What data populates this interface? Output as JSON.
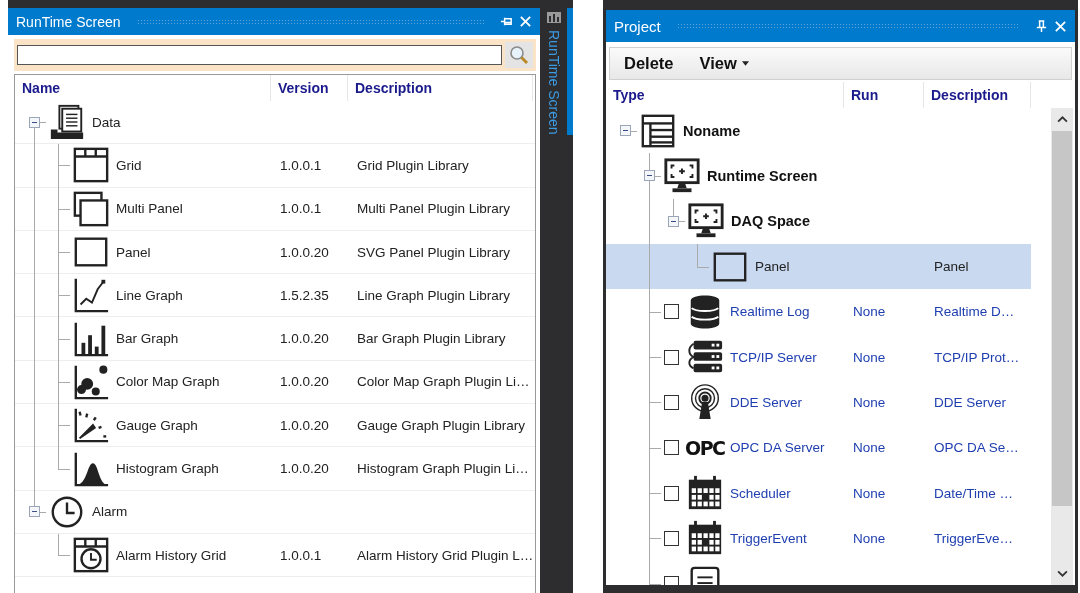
{
  "runtime_panel": {
    "title": "RunTime Screen",
    "columns": [
      "Name",
      "Version",
      "Description"
    ],
    "tree": [
      {
        "name": "Data",
        "kind": "data",
        "expanded": true,
        "children": [
          {
            "name": "Grid",
            "kind": "grid",
            "version": "1.0.0.1",
            "description": "Grid Plugin Library"
          },
          {
            "name": "Multi Panel",
            "kind": "multi-panel",
            "version": "1.0.0.1",
            "description": "Multi Panel Plugin Library"
          },
          {
            "name": "Panel",
            "kind": "panel",
            "version": "1.0.0.20",
            "description": "SVG Panel Plugin Library"
          },
          {
            "name": "Line Graph",
            "kind": "line-graph",
            "version": "1.5.2.35",
            "description": "Line Graph Plugin Library"
          },
          {
            "name": "Bar Graph",
            "kind": "bar-graph",
            "version": "1.0.0.20",
            "description": "Bar Graph Plugin Library"
          },
          {
            "name": "Color Map Graph",
            "kind": "color-map",
            "version": "1.0.0.20",
            "description": "Color Map Graph Plugin Li…"
          },
          {
            "name": "Gauge Graph",
            "kind": "gauge",
            "version": "1.0.0.20",
            "description": "Gauge Graph Plugin Library"
          },
          {
            "name": "Histogram Graph",
            "kind": "histogram",
            "version": "1.0.0.20",
            "description": "Histogram Graph Plugin Li…"
          }
        ]
      },
      {
        "name": "Alarm",
        "kind": "alarm",
        "expanded": true,
        "children": [
          {
            "name": "Alarm History Grid",
            "kind": "alarm-grid",
            "version": "1.0.0.1",
            "description": "Alarm History Grid Plugin L…"
          }
        ]
      }
    ]
  },
  "side_tab": {
    "label": "RunTime Screen"
  },
  "project_panel": {
    "title": "Project",
    "toolbar": [
      {
        "label": "Delete",
        "kind": "button"
      },
      {
        "label": "View",
        "kind": "dropdown"
      }
    ],
    "columns": [
      "Type",
      "Run",
      "Description"
    ],
    "tree": [
      {
        "name": "Noname",
        "kind": "project",
        "expanded": true,
        "selected": false,
        "children": [
          {
            "name": "Runtime Screen",
            "kind": "screen",
            "expanded": true,
            "selected": false,
            "children": [
              {
                "name": "DAQ Space",
                "kind": "screen",
                "expanded": true,
                "selected": false,
                "children": [
                  {
                    "name": "Panel",
                    "kind": "panel",
                    "selected": true,
                    "description": "Panel"
                  }
                ]
              }
            ]
          },
          {
            "name": "Realtime Log",
            "kind": "database",
            "checked": false,
            "selected": false,
            "run": "None",
            "description": "Realtime D…"
          },
          {
            "name": "TCP/IP Server",
            "kind": "server",
            "checked": false,
            "selected": false,
            "run": "None",
            "description": "TCP/IP Prot…"
          },
          {
            "name": "DDE Server",
            "kind": "antenna",
            "checked": false,
            "selected": false,
            "run": "None",
            "description": "DDE Server"
          },
          {
            "name": "OPC DA Server",
            "kind": "opc",
            "logo": "OPC",
            "checked": false,
            "selected": false,
            "run": "None",
            "description": "OPC DA Se…"
          },
          {
            "name": "Scheduler",
            "kind": "calendar",
            "checked": false,
            "selected": false,
            "run": "None",
            "description": "Date/Time …"
          },
          {
            "name": "TriggerEvent",
            "kind": "calendar",
            "checked": false,
            "selected": false,
            "run": "None",
            "description": "TriggerEve…"
          },
          {
            "kind": "report",
            "selected": false
          }
        ]
      }
    ]
  }
}
